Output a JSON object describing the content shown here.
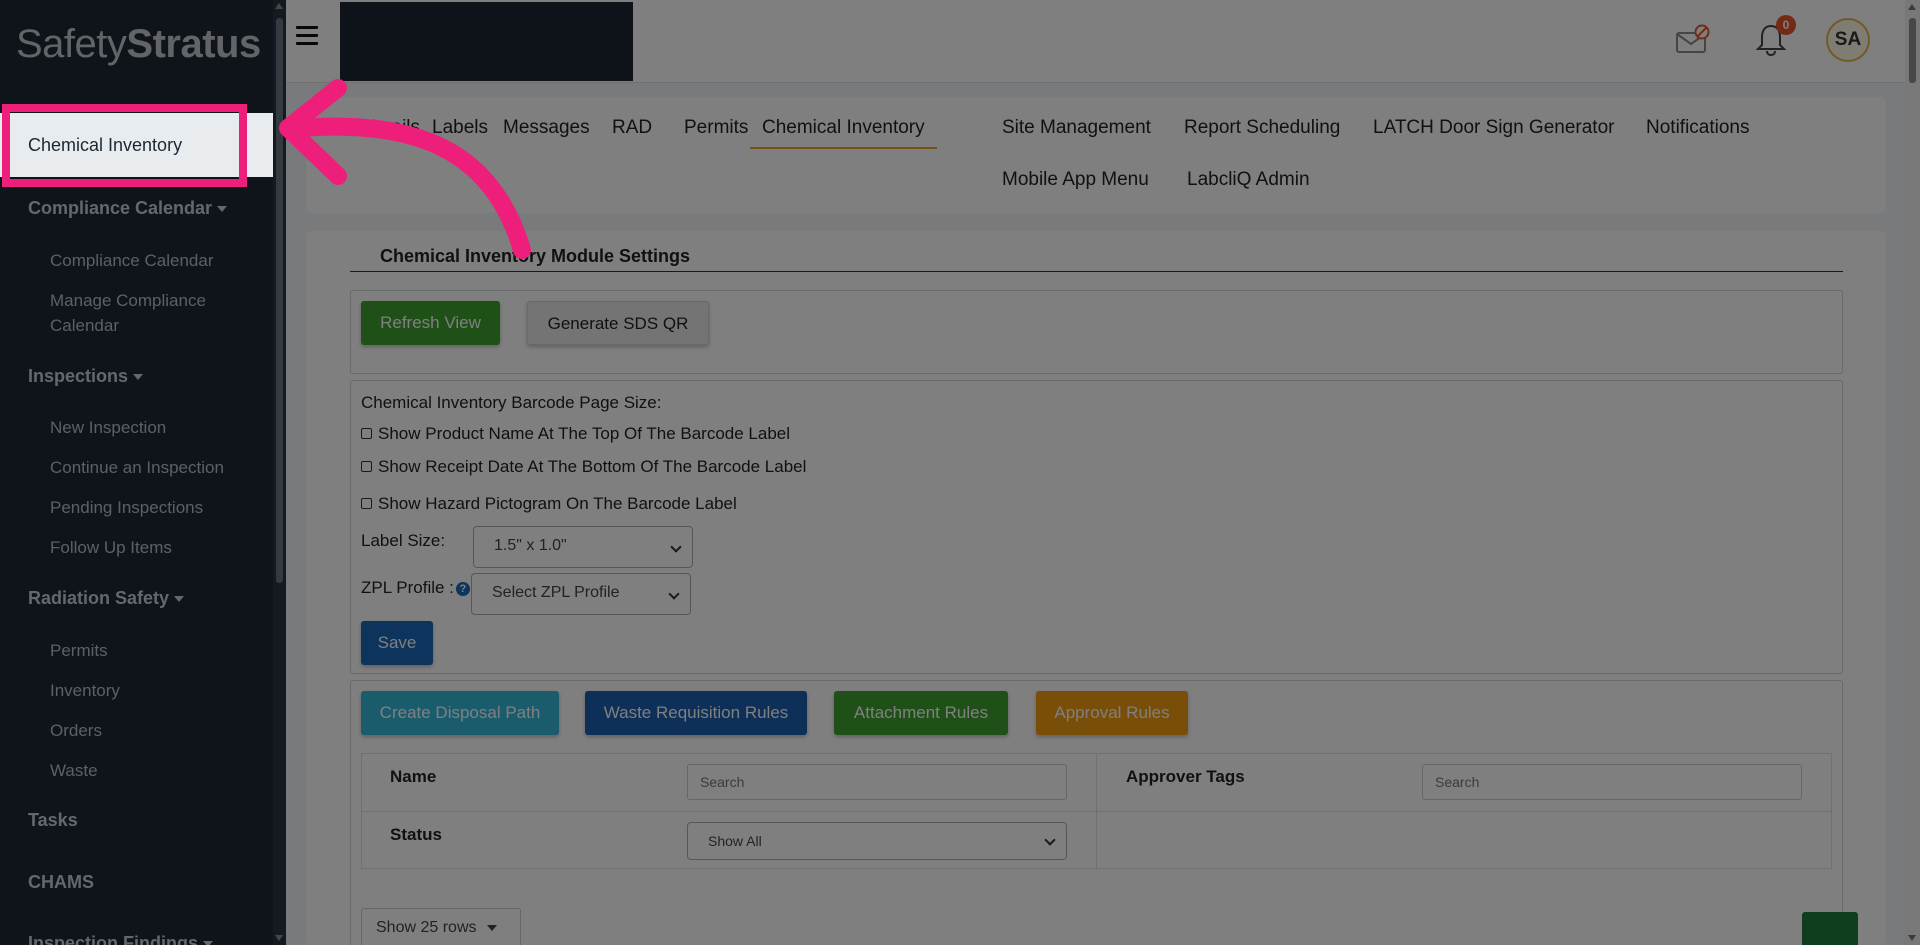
{
  "app": {
    "logo_light": "Safety",
    "logo_bold": "Stratus"
  },
  "sidebar": {
    "active_item": "Chemical Inventory",
    "sections": [
      {
        "title": "Compliance Calendar",
        "items": [
          "Compliance Calendar",
          "Manage Compliance Calendar"
        ]
      },
      {
        "title": "Inspections",
        "items": [
          "New Inspection",
          "Continue an Inspection",
          "Pending Inspections",
          "Follow Up Items"
        ]
      },
      {
        "title": "Radiation Safety",
        "items": [
          "Permits",
          "Inventory",
          "Orders",
          "Waste"
        ]
      }
    ],
    "tasks": "Tasks",
    "chams": "CHAMS",
    "inspection_findings": "Inspection Findings"
  },
  "header": {
    "notification_count": "0",
    "avatar_initials": "SA"
  },
  "tabs": [
    "Emails",
    "Labels",
    "Messages",
    "RAD",
    "Permits",
    "Chemical Inventory",
    "Site Management",
    "Report Scheduling",
    "LATCH Door Sign Generator",
    "Notifications",
    "Mobile App Menu",
    "LabcliQ Admin"
  ],
  "settings": {
    "title": "Chemical Inventory Module Settings",
    "refresh_button": "Refresh View",
    "sds_button": "Generate SDS QR",
    "barcode_page_size": "Chemical Inventory Barcode Page Size:",
    "show_product_name": "Show Product Name At The Top Of The Barcode Label",
    "show_receipt_date": "Show Receipt Date At The Bottom Of The Barcode Label",
    "show_hazard": "Show Hazard Pictogram On The Barcode Label",
    "label_size_label": "Label Size:",
    "label_size_value": "1.5\" x 1.0\"",
    "zpl_label": "ZPL Profile :",
    "zpl_value": "Select ZPL Profile",
    "save_button": "Save"
  },
  "rules": {
    "create_disposal": "Create Disposal Path",
    "waste_requisition": "Waste Requisition Rules",
    "attachment_rules": "Attachment Rules",
    "approval_rules": "Approval Rules",
    "name_label": "Name",
    "name_placeholder": "Search",
    "approver_tags_label": "Approver Tags",
    "approver_placeholder": "Search",
    "status_label": "Status",
    "status_value": "Show All",
    "page_length": "Show 25 rows"
  },
  "colors": {
    "highlight": "#ee1f7a",
    "sidebar_bg": "#1c2833",
    "active_tab_underline": "#e5a42b"
  }
}
